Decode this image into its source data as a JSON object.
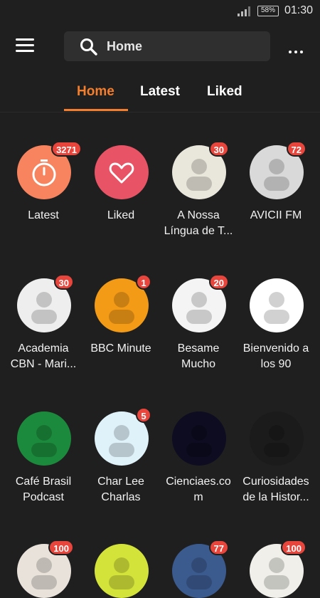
{
  "status_bar": {
    "battery": "58%",
    "time": "01:30"
  },
  "toolbar": {
    "search_text": "Home"
  },
  "tabs": [
    {
      "label": "Home",
      "active": true
    },
    {
      "label": "Latest",
      "active": false
    },
    {
      "label": "Liked",
      "active": false
    }
  ],
  "colors": {
    "accent": "#f37e2d",
    "badge": "#e8453c",
    "background": "#1f1f1f"
  },
  "grid": [
    {
      "name": "latest",
      "label1": "Latest",
      "label2": "",
      "badge": "3271",
      "icon": "stopwatch-icon",
      "bg": "#f7845e"
    },
    {
      "name": "liked",
      "label1": "Liked",
      "label2": "",
      "badge": "",
      "icon": "heart-icon",
      "bg": "#e85466"
    },
    {
      "name": "a-nossa-lingua",
      "label1": "A Nossa",
      "label2": "Língua de T...",
      "badge": "30",
      "icon": "podcast-cover-icon",
      "bg": "#e9e6dc"
    },
    {
      "name": "avicii-fm",
      "label1": "AVICII FM",
      "label2": "",
      "badge": "72",
      "icon": "podcast-cover-icon",
      "bg": "#d9d9d9"
    },
    {
      "name": "academia-cbn",
      "label1": "Academia",
      "label2": "CBN - Mari...",
      "badge": "30",
      "icon": "podcast-cover-icon",
      "bg": "#eeeeee"
    },
    {
      "name": "bbc-minute",
      "label1": "BBC Minute",
      "label2": "",
      "badge": "1",
      "icon": "podcast-cover-icon",
      "bg": "#f39a16"
    },
    {
      "name": "besame-mucho",
      "label1": "Besame",
      "label2": "Mucho",
      "badge": "20",
      "icon": "podcast-cover-icon",
      "bg": "#f4f4f4"
    },
    {
      "name": "bienvenido-a-los-90",
      "label1": "Bienvenido a",
      "label2": "los 90",
      "badge": "",
      "icon": "podcast-cover-icon",
      "bg": "#ffffff"
    },
    {
      "name": "cafe-brasil",
      "label1": "Café Brasil",
      "label2": "Podcast",
      "badge": "",
      "icon": "podcast-cover-icon",
      "bg": "#1c8a3c"
    },
    {
      "name": "char-lee-charlas",
      "label1": "Char Lee",
      "label2": "Charlas",
      "badge": "5",
      "icon": "podcast-cover-icon",
      "bg": "#dff1f9"
    },
    {
      "name": "cienciaes",
      "label1": "Cienciaes.co",
      "label2": "m",
      "badge": "",
      "icon": "podcast-cover-icon",
      "bg": "#0d0c20"
    },
    {
      "name": "curiosidades-historia",
      "label1": "Curiosidades",
      "label2": "de la Histor...",
      "badge": "",
      "icon": "podcast-cover-icon",
      "bg": "#1b1b1b"
    },
    {
      "name": "row4-col1",
      "label1": "",
      "label2": "",
      "badge": "100",
      "icon": "podcast-cover-icon",
      "bg": "#e8e2da"
    },
    {
      "name": "row4-col2",
      "label1": "",
      "label2": "",
      "badge": "",
      "icon": "podcast-cover-icon",
      "bg": "#d4e33a"
    },
    {
      "name": "row4-col3",
      "label1": "",
      "label2": "",
      "badge": "77",
      "icon": "podcast-cover-icon",
      "bg": "#3b5b8f"
    },
    {
      "name": "row4-col4",
      "label1": "",
      "label2": "",
      "badge": "100",
      "icon": "podcast-cover-icon",
      "bg": "#f0efe9"
    }
  ]
}
